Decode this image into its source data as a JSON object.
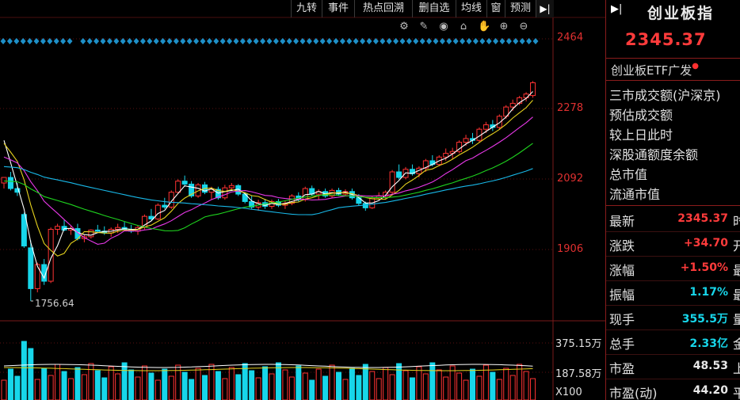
{
  "toolbar": {
    "tabs": [
      "九转",
      "事件",
      "热点回溯",
      "删自选",
      "均线",
      "窗",
      "预测"
    ],
    "end_arrow": "▶|"
  },
  "tools": {
    "icons": [
      "settings-icon",
      "pen-icon",
      "eye-icon",
      "camera-icon",
      "hand-icon",
      "zoom-in-icon",
      "zoom-out-icon"
    ],
    "glyphs": [
      "⚙",
      "✎",
      "◉",
      "⌂",
      "✋",
      "⊕",
      "⊖"
    ]
  },
  "chart_data": {
    "type": "candlestick",
    "price_axis": {
      "ticks": [
        "2464",
        "2278",
        "2092",
        "1906"
      ],
      "range": [
        1756.64,
        2464
      ]
    },
    "low_annotation": "1756.64",
    "volume_axis": {
      "ticks": [
        "375.15万",
        "187.58万"
      ],
      "unit_label": "X100"
    },
    "candles": [
      [
        2075,
        2090,
        2060,
        2090
      ],
      [
        2090,
        2105,
        2055,
        2060
      ],
      [
        2060,
        2075,
        2040,
        2050
      ],
      [
        1990,
        1995,
        1900,
        1905
      ],
      [
        1900,
        1920,
        1756.64,
        1790
      ],
      [
        1790,
        1860,
        1780,
        1855
      ],
      [
        1855,
        1870,
        1800,
        1810
      ],
      [
        1810,
        1955,
        1805,
        1950
      ],
      [
        1950,
        1965,
        1935,
        1958
      ],
      [
        1958,
        1975,
        1945,
        1948
      ],
      [
        1948,
        1960,
        1935,
        1952
      ],
      [
        1952,
        1965,
        1920,
        1925
      ],
      [
        1925,
        1935,
        1915,
        1930
      ],
      [
        1930,
        1950,
        1925,
        1948
      ],
      [
        1948,
        1962,
        1940,
        1945
      ],
      [
        1945,
        1958,
        1935,
        1940
      ],
      [
        1940,
        1955,
        1930,
        1950
      ],
      [
        1950,
        1965,
        1940,
        1955
      ],
      [
        1955,
        1970,
        1945,
        1950
      ],
      [
        1950,
        1962,
        1940,
        1945
      ],
      [
        1945,
        1960,
        1935,
        1955
      ],
      [
        1955,
        1990,
        1950,
        1985
      ],
      [
        1985,
        2005,
        1975,
        1978
      ],
      [
        1978,
        2020,
        1975,
        2015
      ],
      [
        2015,
        2035,
        2005,
        2010
      ],
      [
        2010,
        2055,
        2005,
        2050
      ],
      [
        2050,
        2085,
        2045,
        2080
      ],
      [
        2080,
        2095,
        2065,
        2072
      ],
      [
        2072,
        2080,
        2035,
        2040
      ],
      [
        2040,
        2075,
        2035,
        2070
      ],
      [
        2070,
        2078,
        2045,
        2050
      ],
      [
        2050,
        2065,
        2030,
        2058
      ],
      [
        2058,
        2065,
        2030,
        2035
      ],
      [
        2035,
        2070,
        2030,
        2062
      ],
      [
        2062,
        2075,
        2055,
        2068
      ],
      [
        2068,
        2072,
        2040,
        2045
      ],
      [
        2045,
        2050,
        2020,
        2025
      ],
      [
        2025,
        2040,
        2005,
        2010
      ],
      [
        2010,
        2030,
        2000,
        2022
      ],
      [
        2022,
        2032,
        2005,
        2012
      ],
      [
        2012,
        2030,
        2005,
        2025
      ],
      [
        2025,
        2032,
        2010,
        2015
      ],
      [
        2015,
        2028,
        2005,
        2020
      ],
      [
        2020,
        2045,
        2015,
        2040
      ],
      [
        2040,
        2050,
        2025,
        2030
      ],
      [
        2030,
        2065,
        2025,
        2060
      ],
      [
        2060,
        2068,
        2040,
        2045
      ],
      [
        2045,
        2058,
        2030,
        2052
      ],
      [
        2052,
        2060,
        2035,
        2040
      ],
      [
        2040,
        2060,
        2035,
        2055
      ],
      [
        2055,
        2062,
        2040,
        2045
      ],
      [
        2045,
        2058,
        2040,
        2052
      ],
      [
        2052,
        2060,
        2030,
        2035
      ],
      [
        2035,
        2045,
        2015,
        2020
      ],
      [
        2020,
        2025,
        2000,
        2008
      ],
      [
        2008,
        2040,
        2005,
        2035
      ],
      [
        2035,
        2050,
        2030,
        2040
      ],
      [
        2040,
        2055,
        2030,
        2050
      ],
      [
        2050,
        2110,
        2045,
        2105
      ],
      [
        2105,
        2125,
        2085,
        2090
      ],
      [
        2090,
        2118,
        2085,
        2112
      ],
      [
        2112,
        2125,
        2095,
        2100
      ],
      [
        2100,
        2120,
        2090,
        2115
      ],
      [
        2115,
        2140,
        2105,
        2135
      ],
      [
        2135,
        2150,
        2120,
        2125
      ],
      [
        2125,
        2150,
        2120,
        2145
      ],
      [
        2145,
        2168,
        2135,
        2155
      ],
      [
        2155,
        2170,
        2140,
        2160
      ],
      [
        2160,
        2190,
        2155,
        2185
      ],
      [
        2185,
        2205,
        2175,
        2195
      ],
      [
        2195,
        2210,
        2180,
        2190
      ],
      [
        2190,
        2225,
        2185,
        2220
      ],
      [
        2220,
        2240,
        2210,
        2232
      ],
      [
        2232,
        2245,
        2215,
        2225
      ],
      [
        2225,
        2260,
        2220,
        2255
      ],
      [
        2255,
        2285,
        2248,
        2280
      ],
      [
        2280,
        2300,
        2270,
        2290
      ],
      [
        2290,
        2310,
        2285,
        2305
      ],
      [
        2305,
        2320,
        2295,
        2315
      ],
      [
        2311,
        2350,
        2305,
        2345.37
      ]
    ],
    "volume_colors_pattern": [
      "cyan",
      "red",
      "cyan",
      "red",
      "red",
      "cyan",
      "red"
    ],
    "ma_colors": [
      "#ffffff",
      "#e6d21e",
      "#e838e8",
      "#1ed21e",
      "#18b8e8"
    ]
  },
  "panel": {
    "title": "创业板指",
    "arrow": "▶|",
    "price": "2345.37",
    "etf": "创业板ETF广发",
    "etf_dot": "●",
    "info_lines": [
      "三市成交额(沪深京)",
      "预估成交额",
      "较上日此时",
      "深股通额度余额",
      "总市值",
      "流通市值"
    ],
    "quotes": [
      {
        "label": "最新",
        "value": "2345.37",
        "color": "red",
        "cut": "时"
      },
      {
        "label": "涨跌",
        "value": "+34.70",
        "color": "red",
        "cut": "开"
      },
      {
        "label": "涨幅",
        "value": "+1.50%",
        "color": "red",
        "cut": "最"
      },
      {
        "label": "振幅",
        "value": "1.17%",
        "color": "cyan",
        "cut": "最"
      },
      {
        "label": "现手",
        "value": "355.5万",
        "color": "cyan",
        "cut": "量"
      },
      {
        "label": "总手",
        "value": "2.33亿",
        "color": "cyan",
        "cut": "金"
      },
      {
        "label": "市盈",
        "value": "48.53",
        "color": "white",
        "cut": "上"
      },
      {
        "label": "市盈(动)",
        "value": "44.20",
        "color": "white",
        "cut": "平"
      }
    ]
  }
}
